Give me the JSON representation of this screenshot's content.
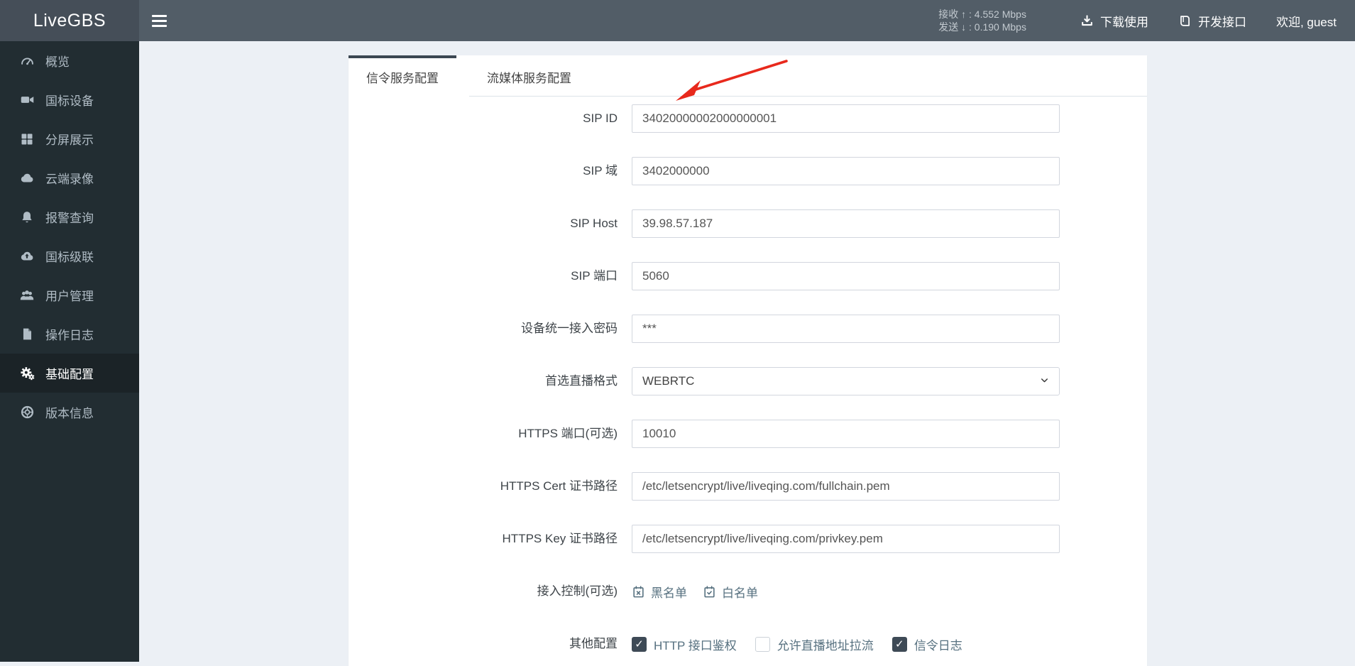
{
  "app": {
    "title": "LiveGBS"
  },
  "navbar": {
    "stats": {
      "recv": {
        "label": "接收",
        "arrow": "↑",
        "sep": ":",
        "value": "4.552 Mbps"
      },
      "send": {
        "label": "发送",
        "arrow": "↓",
        "sep": ":",
        "value": "0.190 Mbps"
      }
    },
    "links": {
      "download": {
        "label": "下载使用",
        "icon": "download-icon"
      },
      "api": {
        "label": "开发接口",
        "icon": "book-icon"
      },
      "welcome": {
        "label": "欢迎, guest"
      }
    }
  },
  "sidebar": {
    "items": [
      {
        "label": "概览",
        "icon": "dashboard-icon",
        "active": false
      },
      {
        "label": "国标设备",
        "icon": "video-camera-icon",
        "active": false
      },
      {
        "label": "分屏展示",
        "icon": "grid-icon",
        "active": false
      },
      {
        "label": "云端录像",
        "icon": "cloud-icon",
        "active": false
      },
      {
        "label": "报警查询",
        "icon": "bell-icon",
        "active": false
      },
      {
        "label": "国标级联",
        "icon": "cloud-upload-icon",
        "active": false
      },
      {
        "label": "用户管理",
        "icon": "users-icon",
        "active": false
      },
      {
        "label": "操作日志",
        "icon": "file-icon",
        "active": false
      },
      {
        "label": "基础配置",
        "icon": "gears-icon",
        "active": true
      },
      {
        "label": "版本信息",
        "icon": "version-ring-icon",
        "active": false
      }
    ]
  },
  "tabs": [
    {
      "label": "信令服务配置",
      "active": true
    },
    {
      "label": "流媒体服务配置",
      "active": false
    }
  ],
  "form": {
    "fields": [
      {
        "label": "SIP ID",
        "value": "34020000002000000001",
        "type": "text"
      },
      {
        "label": "SIP 域",
        "value": "3402000000",
        "type": "text"
      },
      {
        "label": "SIP Host",
        "value": "39.98.57.187",
        "type": "text"
      },
      {
        "label": "SIP 端口",
        "value": "5060",
        "type": "text"
      },
      {
        "label": "设备统一接入密码",
        "value": "***",
        "type": "text"
      },
      {
        "label": "首选直播格式",
        "value": "WEBRTC",
        "type": "select"
      },
      {
        "label": "HTTPS 端口(可选)",
        "value": "10010",
        "type": "text"
      },
      {
        "label": "HTTPS Cert 证书路径",
        "value": "/etc/letsencrypt/live/liveqing.com/fullchain.pem",
        "type": "text"
      },
      {
        "label": "HTTPS Key 证书路径",
        "value": "/etc/letsencrypt/live/liveqing.com/privkey.pem",
        "type": "text"
      }
    ],
    "access_control": {
      "label": "接入控制(可选)",
      "links": [
        {
          "label": "黑名单",
          "icon": "calendar-x-icon"
        },
        {
          "label": "白名单",
          "icon": "calendar-check-icon"
        }
      ]
    },
    "other": {
      "label": "其他配置",
      "checkboxes": [
        {
          "label": "HTTP 接口鉴权",
          "checked": true
        },
        {
          "label": "允许直播地址拉流",
          "checked": false
        },
        {
          "label": "信令日志",
          "checked": true
        }
      ]
    }
  },
  "annotation": {
    "shape": "red-arrow",
    "color": "#e8291c"
  },
  "colors": {
    "navbar_bg": "#525d67",
    "logo_bg": "#454e58",
    "sidebar_bg": "#222d32",
    "sidebar_active_bg": "#1b2327",
    "accent_tab": "#3b4752",
    "link_steel": "#56707f",
    "content_bg": "#ecf0f5",
    "input_border": "#d2d6de",
    "annotation_red": "#e8291c"
  }
}
